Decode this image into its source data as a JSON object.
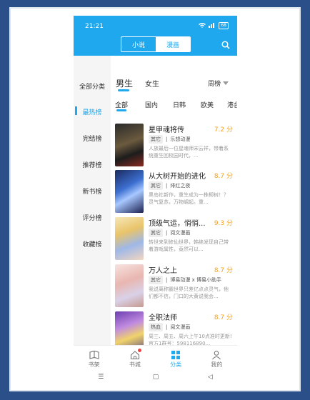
{
  "status": {
    "time": "21:21",
    "battery": "68"
  },
  "header": {
    "tabs": [
      "小说",
      "漫画"
    ],
    "active_tab": "漫画"
  },
  "sidebar": {
    "items": [
      "全部分类",
      "最热榜",
      "完结榜",
      "推荐榜",
      "新书榜",
      "评分榜",
      "收藏榜"
    ],
    "active": "最热榜"
  },
  "gender_tabs": [
    "男生",
    "女生"
  ],
  "rank_period": "周榜",
  "regions": [
    "全部",
    "国内",
    "日韩",
    "欧美",
    "港台"
  ],
  "books": [
    {
      "title": "星甲魂将传",
      "score": "7.2 分",
      "tag": "其它",
      "author": "乐想动漫",
      "desc": "人族最后一位星魂师宋云祥，带着系统重生回校园时代，..."
    },
    {
      "title": "从大树开始的进化",
      "score": "8.7 分",
      "tag": "其它",
      "author": "绯红之夜",
      "desc": "黑岛社新作，重生成为一株柳树！？灵气复苏，万物崛起。重..."
    },
    {
      "title": "顶级气运，悄悄...",
      "score": "9.3 分",
      "tag": "其它",
      "author": "阅文漫画",
      "desc": "转世来到修仙世界，韩绝发现自己带着游戏属性，竟然可以..."
    },
    {
      "title": "万人之上",
      "score": "8.7 分",
      "tag": "其它",
      "author": "博易动漫 x 博易小助手",
      "desc": "我说离称霸世界只差亿点点灵气，他们都不信，门口的大黄说我会..."
    },
    {
      "title": "全职法师",
      "score": "8.7 分",
      "tag": "热血",
      "author": "阅文漫画",
      "desc": "周三、周五、周六上午10点准时更新! 官方1群号：598116890..."
    }
  ],
  "bottom_tabs": [
    "书架",
    "书城",
    "分类",
    "我的"
  ],
  "active_bottom": "分类",
  "colors": {
    "accent": "#1fa8ee",
    "score": "#f3a020"
  }
}
